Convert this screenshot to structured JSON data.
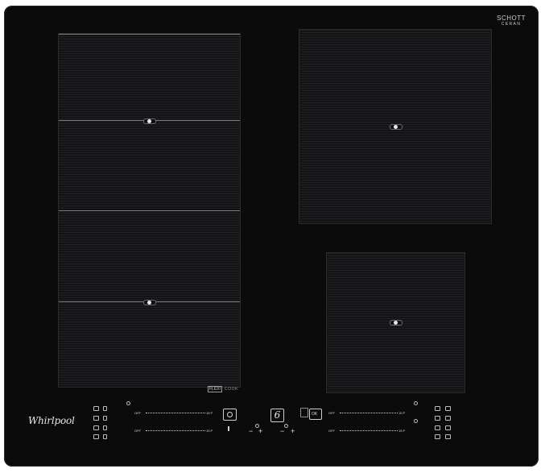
{
  "brand": {
    "hob_maker": "Whirlpool",
    "glass_line1": "SCHOTT",
    "glass_line2": "CERAN"
  },
  "flexi_badge": {
    "box": "FLEXI",
    "text": "COOK"
  },
  "controls": {
    "left_row1": {
      "off": "OFF",
      "max": "15 P"
    },
    "left_row2": {
      "off": "OFF",
      "max": "15 P"
    },
    "right_row1": {
      "off": "OFF",
      "max": "15 P"
    },
    "right_row2": {
      "off": "OFF",
      "max": "15 P"
    },
    "center_display": "6",
    "ok_label": "OK",
    "plus": "+",
    "minus": "−"
  },
  "colors": {
    "glass": "#0b0b0c",
    "print": "#d8d8d8"
  }
}
